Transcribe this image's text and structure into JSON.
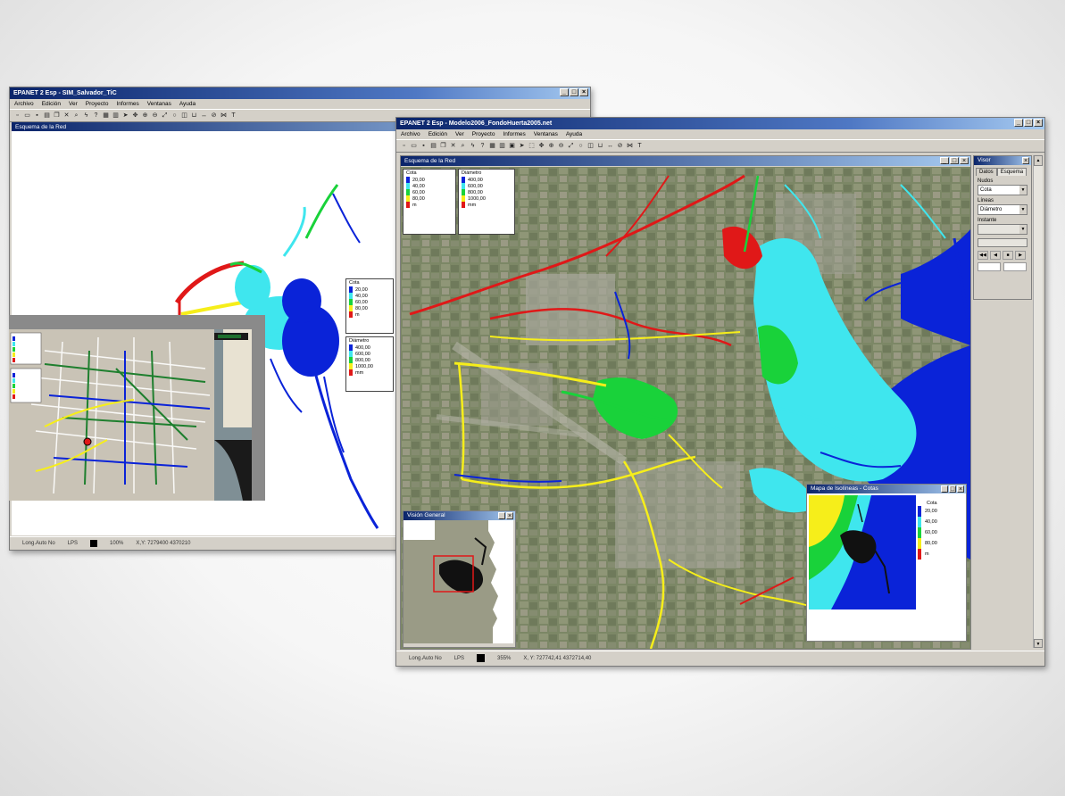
{
  "back_window": {
    "title": "EPANET 2 Esp - SIM_Salvador_TiC",
    "menu": [
      "Archivo",
      "Edición",
      "Ver",
      "Proyecto",
      "Informes",
      "Ventanas",
      "Ayuda"
    ],
    "map_title": "Esquema de la Red",
    "legend_nodes": {
      "title": "Cota",
      "values": [
        "20,00",
        "40,00",
        "60,00",
        "80,00"
      ],
      "unit": "m"
    },
    "legend_links": {
      "title": "Diámetro",
      "values": [
        "400,00",
        "600,00",
        "800,00",
        "1000,00"
      ],
      "unit": "mm"
    },
    "status": {
      "autolength": "Long.Auto No",
      "units": "LPS",
      "zoom": "100%",
      "coords": "X,Y: 7279400   4370210"
    }
  },
  "front_window": {
    "title": "EPANET 2 Esp - Modelo2006_FondoHuerta2005.net",
    "menu": [
      "Archivo",
      "Edición",
      "Ver",
      "Proyecto",
      "Informes",
      "Ventanas",
      "Ayuda"
    ],
    "map_title": "Esquema de la Red",
    "legend_nodes": {
      "title": "Cota",
      "values": [
        "20,00",
        "40,00",
        "60,00",
        "80,00"
      ],
      "unit": "m"
    },
    "legend_links": {
      "title": "Diámetro",
      "values": [
        "400,00",
        "600,00",
        "800,00",
        "1000,00"
      ],
      "unit": "mm"
    },
    "browser": {
      "title": "Visor",
      "tabs": [
        "Datos",
        "Esquema"
      ],
      "nodes_label": "Nudos",
      "nodes_value": "Cota",
      "links_label": "Líneas",
      "links_value": "Diámetro",
      "time_label": "Instante"
    },
    "overview": {
      "title": "Visión General"
    },
    "contour": {
      "title": "Mapa de Isolíneas - Cotas",
      "legend_title": "Cota",
      "values": [
        "20,00",
        "40,00",
        "60,00",
        "80,00"
      ],
      "unit": "m"
    },
    "status": {
      "autolength": "Long.Auto No",
      "units": "LPS",
      "zoom": "355%",
      "coords": "X, Y: 727742,41   4372714,40"
    }
  },
  "colors": {
    "blue": "#0a23d8",
    "cyan": "#3fe6ee",
    "green": "#19d23a",
    "yellow": "#f6ee1a",
    "red": "#e01818",
    "navy": "#0a246a",
    "satellite": "#7f8a6a"
  }
}
